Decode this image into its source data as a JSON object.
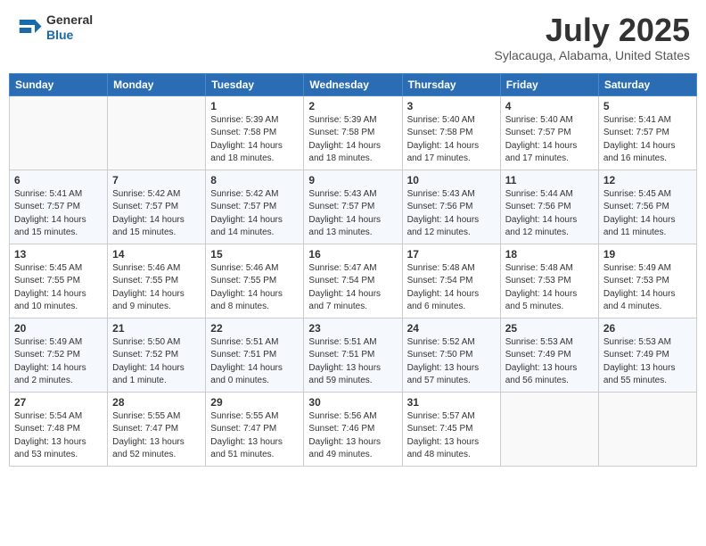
{
  "header": {
    "logo_general": "General",
    "logo_blue": "Blue",
    "month_title": "July 2025",
    "location": "Sylacauga, Alabama, United States"
  },
  "days_of_week": [
    "Sunday",
    "Monday",
    "Tuesday",
    "Wednesday",
    "Thursday",
    "Friday",
    "Saturday"
  ],
  "weeks": [
    [
      {
        "day": "",
        "content": ""
      },
      {
        "day": "",
        "content": ""
      },
      {
        "day": "1",
        "content": "Sunrise: 5:39 AM\nSunset: 7:58 PM\nDaylight: 14 hours and 18 minutes."
      },
      {
        "day": "2",
        "content": "Sunrise: 5:39 AM\nSunset: 7:58 PM\nDaylight: 14 hours and 18 minutes."
      },
      {
        "day": "3",
        "content": "Sunrise: 5:40 AM\nSunset: 7:58 PM\nDaylight: 14 hours and 17 minutes."
      },
      {
        "day": "4",
        "content": "Sunrise: 5:40 AM\nSunset: 7:57 PM\nDaylight: 14 hours and 17 minutes."
      },
      {
        "day": "5",
        "content": "Sunrise: 5:41 AM\nSunset: 7:57 PM\nDaylight: 14 hours and 16 minutes."
      }
    ],
    [
      {
        "day": "6",
        "content": "Sunrise: 5:41 AM\nSunset: 7:57 PM\nDaylight: 14 hours and 15 minutes."
      },
      {
        "day": "7",
        "content": "Sunrise: 5:42 AM\nSunset: 7:57 PM\nDaylight: 14 hours and 15 minutes."
      },
      {
        "day": "8",
        "content": "Sunrise: 5:42 AM\nSunset: 7:57 PM\nDaylight: 14 hours and 14 minutes."
      },
      {
        "day": "9",
        "content": "Sunrise: 5:43 AM\nSunset: 7:57 PM\nDaylight: 14 hours and 13 minutes."
      },
      {
        "day": "10",
        "content": "Sunrise: 5:43 AM\nSunset: 7:56 PM\nDaylight: 14 hours and 12 minutes."
      },
      {
        "day": "11",
        "content": "Sunrise: 5:44 AM\nSunset: 7:56 PM\nDaylight: 14 hours and 12 minutes."
      },
      {
        "day": "12",
        "content": "Sunrise: 5:45 AM\nSunset: 7:56 PM\nDaylight: 14 hours and 11 minutes."
      }
    ],
    [
      {
        "day": "13",
        "content": "Sunrise: 5:45 AM\nSunset: 7:55 PM\nDaylight: 14 hours and 10 minutes."
      },
      {
        "day": "14",
        "content": "Sunrise: 5:46 AM\nSunset: 7:55 PM\nDaylight: 14 hours and 9 minutes."
      },
      {
        "day": "15",
        "content": "Sunrise: 5:46 AM\nSunset: 7:55 PM\nDaylight: 14 hours and 8 minutes."
      },
      {
        "day": "16",
        "content": "Sunrise: 5:47 AM\nSunset: 7:54 PM\nDaylight: 14 hours and 7 minutes."
      },
      {
        "day": "17",
        "content": "Sunrise: 5:48 AM\nSunset: 7:54 PM\nDaylight: 14 hours and 6 minutes."
      },
      {
        "day": "18",
        "content": "Sunrise: 5:48 AM\nSunset: 7:53 PM\nDaylight: 14 hours and 5 minutes."
      },
      {
        "day": "19",
        "content": "Sunrise: 5:49 AM\nSunset: 7:53 PM\nDaylight: 14 hours and 4 minutes."
      }
    ],
    [
      {
        "day": "20",
        "content": "Sunrise: 5:49 AM\nSunset: 7:52 PM\nDaylight: 14 hours and 2 minutes."
      },
      {
        "day": "21",
        "content": "Sunrise: 5:50 AM\nSunset: 7:52 PM\nDaylight: 14 hours and 1 minute."
      },
      {
        "day": "22",
        "content": "Sunrise: 5:51 AM\nSunset: 7:51 PM\nDaylight: 14 hours and 0 minutes."
      },
      {
        "day": "23",
        "content": "Sunrise: 5:51 AM\nSunset: 7:51 PM\nDaylight: 13 hours and 59 minutes."
      },
      {
        "day": "24",
        "content": "Sunrise: 5:52 AM\nSunset: 7:50 PM\nDaylight: 13 hours and 57 minutes."
      },
      {
        "day": "25",
        "content": "Sunrise: 5:53 AM\nSunset: 7:49 PM\nDaylight: 13 hours and 56 minutes."
      },
      {
        "day": "26",
        "content": "Sunrise: 5:53 AM\nSunset: 7:49 PM\nDaylight: 13 hours and 55 minutes."
      }
    ],
    [
      {
        "day": "27",
        "content": "Sunrise: 5:54 AM\nSunset: 7:48 PM\nDaylight: 13 hours and 53 minutes."
      },
      {
        "day": "28",
        "content": "Sunrise: 5:55 AM\nSunset: 7:47 PM\nDaylight: 13 hours and 52 minutes."
      },
      {
        "day": "29",
        "content": "Sunrise: 5:55 AM\nSunset: 7:47 PM\nDaylight: 13 hours and 51 minutes."
      },
      {
        "day": "30",
        "content": "Sunrise: 5:56 AM\nSunset: 7:46 PM\nDaylight: 13 hours and 49 minutes."
      },
      {
        "day": "31",
        "content": "Sunrise: 5:57 AM\nSunset: 7:45 PM\nDaylight: 13 hours and 48 minutes."
      },
      {
        "day": "",
        "content": ""
      },
      {
        "day": "",
        "content": ""
      }
    ]
  ]
}
